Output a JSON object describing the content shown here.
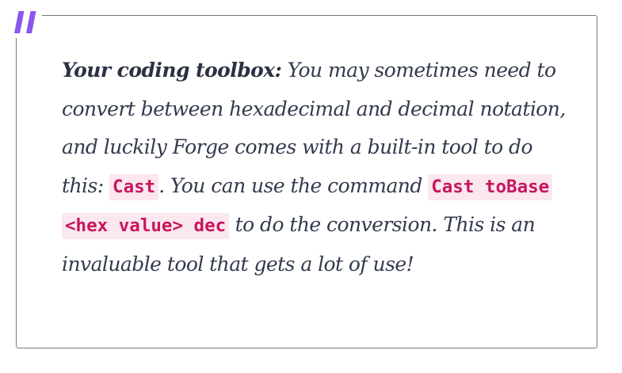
{
  "callout": {
    "lead": "Your coding toolbox:",
    "text_1": " You may sometimes need to convert between hexadecimal and decimal notation, and luckily Forge comes with a built-in tool to do this: ",
    "code_1": "Cast",
    "text_2": ". You can use the command ",
    "code_2": "Cast toBase <hex value> dec",
    "text_3": " to do the conversion. This is an invaluable tool that gets a lot of use!"
  },
  "colors": {
    "quote_mark": "#8a56f0",
    "border": "#7a7a7a",
    "text": "#333a4d",
    "code_text": "#c7155f",
    "code_background": "#fbe7ee"
  },
  "icons": {
    "quote": "quote-icon"
  }
}
